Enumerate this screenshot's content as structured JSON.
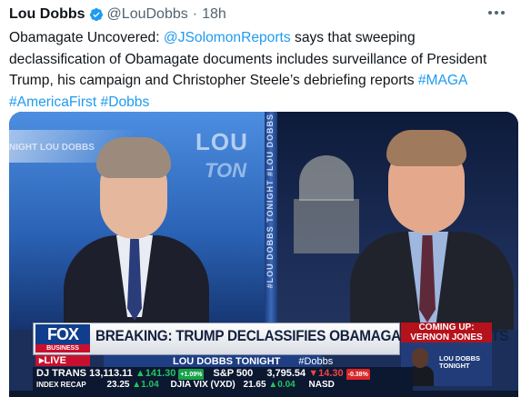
{
  "tweet": {
    "author_name": "Lou Dobbs",
    "handle": "@LouDobbs",
    "separator": "·",
    "time": "18h",
    "body_parts": [
      {
        "text": "Obamagate Uncovered: ",
        "link": false
      },
      {
        "text": "@JSolomonReports",
        "link": true
      },
      {
        "text": " says that sweeping declassification of Obamagate documents includes surveillance of President Trump, his campaign and Christopher Steele’s debriefing reports ",
        "link": false
      },
      {
        "text": "#MAGA",
        "link": true
      },
      {
        "text": " ",
        "link": false
      },
      {
        "text": "#AmericaFirst",
        "link": true
      },
      {
        "text": " ",
        "link": false
      },
      {
        "text": "#Dobbs",
        "link": true
      }
    ]
  },
  "media": {
    "studio_brand": "LOU",
    "studio_brand_sub": "TON",
    "studio_wall_text": "NIGHT LOU DOBBS",
    "divider_text": "#LOU DOBBS TONIGHT #LOU DOBBS",
    "chyron": "BREAKING: TRUMP DECLASSIFIES OBAMAGATE DOCUMENTS",
    "network": "FOX",
    "network_sub": "BUSINESS",
    "live": "LIVE",
    "show_name": "LOU DOBBS TONIGHT",
    "show_tag": "#Dobbs",
    "coming_up_label": "COMING UP:",
    "coming_up_name": "VERNON JONES",
    "promo_text": "LOU DOBBS TONIGHT",
    "ticker_row1": {
      "dj_label": "DJ TRANS",
      "dj_value": "13,113.11",
      "dj_change": "▲141.30",
      "dj_pct": "+1.09%",
      "sp_label": "S&P 500",
      "sp_value": "3,795.54",
      "sp_change": "▼14.30",
      "sp_pct": "-0.38%"
    },
    "ticker_row2": {
      "recap_label": "INDEX RECAP",
      "recap_value": "23.25",
      "recap_change": "▲1.04",
      "vix_label": "DJIA VIX (VXD)",
      "vix_value": "21.65",
      "vix_change": "▲0.04",
      "nasd": "NASD"
    }
  },
  "colors": {
    "link": "#1d9bf0",
    "verified": "#1d9bf0",
    "muted": "#536471"
  }
}
